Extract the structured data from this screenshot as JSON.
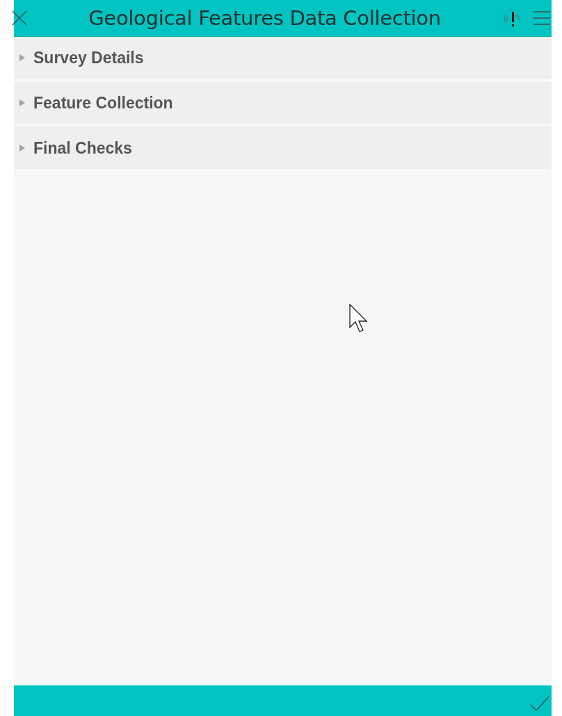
{
  "header": {
    "title": "Geological Features Data Collection"
  },
  "groups": [
    {
      "label": "Survey Details",
      "expanded": false
    },
    {
      "label": "Feature Collection",
      "expanded": false
    },
    {
      "label": "Final Checks",
      "expanded": false
    }
  ]
}
